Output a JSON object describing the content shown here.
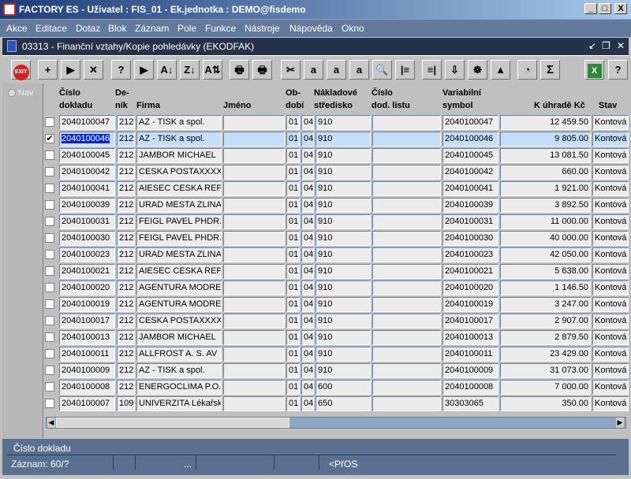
{
  "window": {
    "title": "FACTORY ES - Uživatel : FIS_01 - Ek.jednotka : DEMO@fisdemo",
    "min": "_",
    "max": "□",
    "close": "X"
  },
  "menu": [
    "Akce",
    "Editace",
    "Dotaz",
    "Blok",
    "Záznam",
    "Pole",
    "Funkce",
    "Nástroje",
    "Nápověda",
    "Okno"
  ],
  "form": {
    "title": "03313 - Finanční vztahy/Kopie pohledávky (EKODFAK)"
  },
  "toolbar": [
    {
      "icon": "exit-icon",
      "label": "EXIT"
    },
    {
      "icon": "insert-record-icon",
      "label": "+"
    },
    {
      "icon": "save-icon",
      "label": "▶"
    },
    {
      "icon": "delete-record-icon",
      "label": "✕"
    },
    {
      "icon": "query-icon",
      "label": "?"
    },
    {
      "icon": "execute-query-icon",
      "label": "▶"
    },
    {
      "icon": "sort-asc-icon",
      "label": "A↓"
    },
    {
      "icon": "sort-desc-icon",
      "label": "Z↓"
    },
    {
      "icon": "sort-multi-icon",
      "label": "A⇅"
    },
    {
      "icon": "print-icon",
      "label": "🖶"
    },
    {
      "icon": "print-setup-icon",
      "label": "🖶"
    },
    {
      "icon": "cut-icon",
      "label": "✂"
    },
    {
      "icon": "copy-icon",
      "label": "a"
    },
    {
      "icon": "paste-icon",
      "label": "a"
    },
    {
      "icon": "paste-special-icon",
      "label": "a"
    },
    {
      "icon": "search-icon",
      "label": "🔍"
    },
    {
      "icon": "column-left-icon",
      "label": "|≡"
    },
    {
      "icon": "column-right-icon",
      "label": "≡|"
    },
    {
      "icon": "import-icon",
      "label": "⇩"
    },
    {
      "icon": "wheel-icon",
      "label": "☸"
    },
    {
      "icon": "alert-icon",
      "label": "▲"
    },
    {
      "icon": "calendar-icon",
      "label": "◔"
    },
    {
      "icon": "sum-icon",
      "label": "Σ"
    },
    {
      "icon": "excel-icon",
      "label": "X"
    },
    {
      "icon": "help-icon",
      "label": "?"
    },
    {
      "icon": "context-help-icon",
      "label": "?"
    }
  ],
  "nav": {
    "label": "Nav"
  },
  "columns": {
    "cislo": "Číslo",
    "cislo2": "dokladu",
    "denik": "De-",
    "denik2": "ník",
    "firma": "Firma",
    "jmeno": "Jméno",
    "obd": "Ob-",
    "obd2": "dobí",
    "str": "Nákladové",
    "str2": "středisko",
    "dod": "Číslo",
    "dod2": "dod. listu",
    "var": "Variabilní",
    "var2": "symbol",
    "kuhr": "K úhradě Kč",
    "stav": "Stav"
  },
  "rows": [
    {
      "checked": false,
      "cislo": "2040100047",
      "denik": "212",
      "firma": "AZ - TISK a spol.",
      "jmeno": "",
      "o1": "01",
      "o2": "04",
      "str": "910",
      "dod": "",
      "var": "2040100047",
      "kuhr": "12 459.50",
      "stav": "Kontová"
    },
    {
      "checked": true,
      "cislo": "2040100046",
      "denik": "212",
      "firma": "AZ - TISK a spol.",
      "jmeno": "",
      "o1": "01",
      "o2": "04",
      "str": "910",
      "dod": "",
      "var": "2040100046",
      "kuhr": "9 805.00",
      "stav": "Kontová"
    },
    {
      "checked": false,
      "cislo": "2040100045",
      "denik": "212",
      "firma": "JAMBOR MICHAEL",
      "jmeno": "",
      "o1": "01",
      "o2": "04",
      "str": "910",
      "dod": "",
      "var": "2040100045",
      "kuhr": "13 081.50",
      "stav": "Kontová"
    },
    {
      "checked": false,
      "cislo": "2040100042",
      "denik": "212",
      "firma": "CESKA POSTAXXXXX",
      "jmeno": "",
      "o1": "01",
      "o2": "04",
      "str": "910",
      "dod": "",
      "var": "2040100042",
      "kuhr": "660.00",
      "stav": "Kontová"
    },
    {
      "checked": false,
      "cislo": "2040100041",
      "denik": "212",
      "firma": "AIESEC  CESKA REPU",
      "jmeno": "",
      "o1": "01",
      "o2": "04",
      "str": "910",
      "dod": "",
      "var": "2040100041",
      "kuhr": "1 921.00",
      "stav": "Kontová"
    },
    {
      "checked": false,
      "cislo": "2040100039",
      "denik": "212",
      "firma": "URAD MESTA ZLINA",
      "jmeno": "",
      "o1": "01",
      "o2": "04",
      "str": "910",
      "dod": "",
      "var": "2040100039",
      "kuhr": "3 892.50",
      "stav": "Kontová"
    },
    {
      "checked": false,
      "cislo": "2040100031",
      "denik": "212",
      "firma": "FEIGL PAVEL PHDR.",
      "jmeno": "",
      "o1": "01",
      "o2": "04",
      "str": "910",
      "dod": "",
      "var": "2040100031",
      "kuhr": "11 000.00",
      "stav": "Kontová"
    },
    {
      "checked": false,
      "cislo": "2040100030",
      "denik": "212",
      "firma": "FEIGL PAVEL PHDR.",
      "jmeno": "",
      "o1": "01",
      "o2": "04",
      "str": "910",
      "dod": "",
      "var": "2040100030",
      "kuhr": "40 000.00",
      "stav": "Kontová"
    },
    {
      "checked": false,
      "cislo": "2040100023",
      "denik": "212",
      "firma": "URAD MESTA ZLINA",
      "jmeno": "",
      "o1": "01",
      "o2": "04",
      "str": "910",
      "dod": "",
      "var": "2040100023",
      "kuhr": "42 050.00",
      "stav": "Kontová"
    },
    {
      "checked": false,
      "cislo": "2040100021",
      "denik": "212",
      "firma": "AIESEC  CESKA REPU",
      "jmeno": "",
      "o1": "01",
      "o2": "04",
      "str": "910",
      "dod": "",
      "var": "2040100021",
      "kuhr": "5 638.00",
      "stav": "Kontová"
    },
    {
      "checked": false,
      "cislo": "2040100020",
      "denik": "212",
      "firma": "AGENTURA MODRE S",
      "jmeno": "",
      "o1": "01",
      "o2": "04",
      "str": "910",
      "dod": "",
      "var": "2040100020",
      "kuhr": "1 146.50",
      "stav": "Kontová"
    },
    {
      "checked": false,
      "cislo": "2040100019",
      "denik": "212",
      "firma": "AGENTURA MODRE S",
      "jmeno": "",
      "o1": "01",
      "o2": "04",
      "str": "910",
      "dod": "",
      "var": "2040100019",
      "kuhr": "3 247.00",
      "stav": "Kontová"
    },
    {
      "checked": false,
      "cislo": "2040100017",
      "denik": "212",
      "firma": "CESKA POSTAXXXXX",
      "jmeno": "",
      "o1": "01",
      "o2": "04",
      "str": "910",
      "dod": "",
      "var": "2040100017",
      "kuhr": "2 907.00",
      "stav": "Kontová"
    },
    {
      "checked": false,
      "cislo": "2040100013",
      "denik": "212",
      "firma": "JAMBOR MICHAEL",
      "jmeno": "",
      "o1": "01",
      "o2": "04",
      "str": "910",
      "dod": "",
      "var": "2040100013",
      "kuhr": "2 879.50",
      "stav": "Kontová"
    },
    {
      "checked": false,
      "cislo": "2040100011",
      "denik": "212",
      "firma": "ALLFROST A. S. AV",
      "jmeno": "",
      "o1": "01",
      "o2": "04",
      "str": "910",
      "dod": "",
      "var": "2040100011",
      "kuhr": "23 429.00",
      "stav": "Kontová"
    },
    {
      "checked": false,
      "cislo": "2040100009",
      "denik": "212",
      "firma": "AZ - TISK a spol.",
      "jmeno": "",
      "o1": "01",
      "o2": "04",
      "str": "910",
      "dod": "",
      "var": "2040100009",
      "kuhr": "31 073.00",
      "stav": "Kontová"
    },
    {
      "checked": false,
      "cislo": "2040100008",
      "denik": "212",
      "firma": "ENERGOCLIMA P.O.B",
      "jmeno": "",
      "o1": "01",
      "o2": "04",
      "str": "600",
      "dod": "",
      "var": "2040100008",
      "kuhr": "7 000.00",
      "stav": "Kontová"
    },
    {
      "checked": false,
      "cislo": "2040100007",
      "denik": "109",
      "firma": "UNIVERZITA Lékařská",
      "jmeno": "",
      "o1": "01",
      "o2": "04",
      "str": "650",
      "dod": "",
      "var": "30303065",
      "kuhr": "350.00",
      "stav": "Kontová"
    }
  ],
  "status": {
    "hint": "Číslo dokladu",
    "record": "Záznam: 60/?",
    "dots": "...",
    "mode": "<PřOS"
  }
}
